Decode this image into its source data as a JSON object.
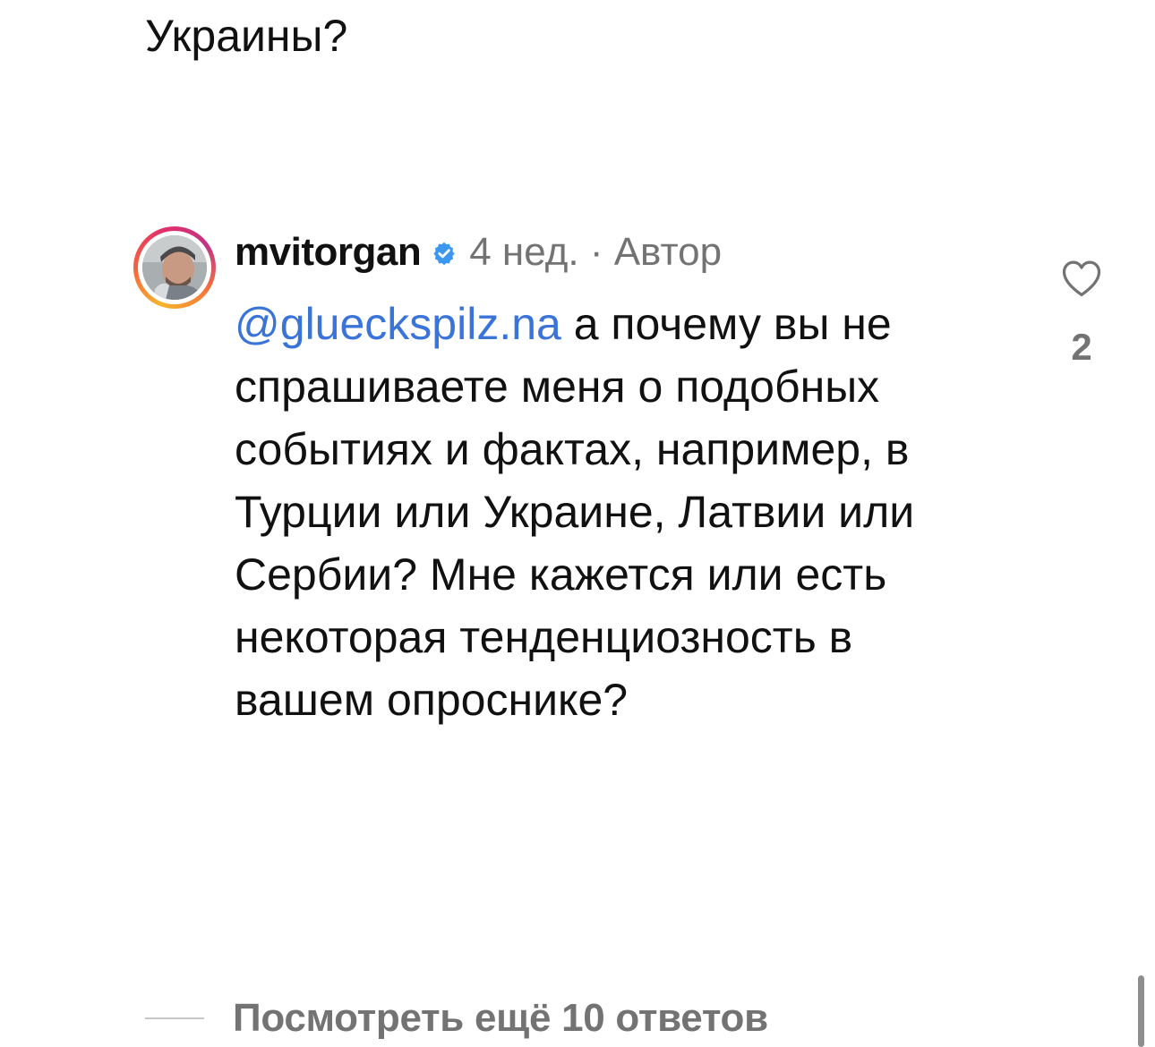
{
  "previous_comment": {
    "tail_text": "Украины?"
  },
  "comment": {
    "username": "mvitorgan",
    "verified_icon": "verified-badge-icon",
    "meta": "4 нед. · Автор",
    "mention": "@glueckspilz.na",
    "text": " а почему вы не спрашиваете меня о подобных событиях и фактах, например, в Турции или Украине, Латвии или Сербии? Мне кажется или есть некоторая тенденциозность в вашем опроснике?",
    "like_icon": "heart-outline-icon",
    "like_count": "2"
  },
  "replies": {
    "label": "Посмотреть ещё 10 ответов"
  },
  "colors": {
    "mention": "#3a74d8",
    "verified": "#3b97f0",
    "meta": "#737373"
  }
}
